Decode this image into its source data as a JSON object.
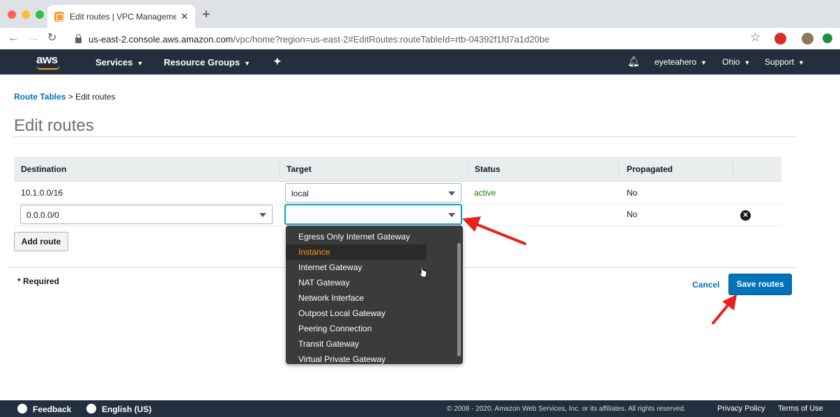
{
  "browser": {
    "tab_title": "Edit routes | VPC Management",
    "tab_close": "✕",
    "new_tab": "+",
    "url_host": "us-east-2.console.aws.amazon.com",
    "url_path": "/vpc/home?region=us-east-2#EditRoutes:routeTableId=rtb-04392f1fd7a1d20be",
    "traffic_colors": [
      "#fe5f57",
      "#febc2e",
      "#28c840"
    ]
  },
  "aws_header": {
    "logo": "aws",
    "services": "Services",
    "resource_groups": "Resource Groups",
    "user": "eyeteahero",
    "region": "Ohio",
    "support": "Support"
  },
  "breadcrumb": {
    "parent": "Route Tables",
    "separator": ">",
    "current": "Edit routes"
  },
  "page_title": "Edit routes",
  "table": {
    "headers": [
      "Destination",
      "Target",
      "Status",
      "Propagated"
    ],
    "rows": [
      {
        "destination": "10.1.0.0/16",
        "target": "local",
        "status": "active",
        "propagated": "No"
      },
      {
        "destination": "0.0.0.0/0",
        "target": "",
        "status": "",
        "propagated": "No"
      }
    ]
  },
  "buttons": {
    "add_route": "Add route",
    "required": "* Required",
    "cancel": "Cancel",
    "save": "Save routes"
  },
  "dropdown": {
    "items": [
      "Egress Only Internet Gateway",
      "Instance",
      "Internet Gateway",
      "NAT Gateway",
      "Network Interface",
      "Outpost Local Gateway",
      "Peering Connection",
      "Transit Gateway",
      "Virtual Private Gateway"
    ],
    "highlighted": "Instance"
  },
  "footer": {
    "feedback": "Feedback",
    "language": "English (US)",
    "copyright": "© 2008 - 2020, Amazon Web Services, Inc. or its affiliates. All rights reserved.",
    "privacy": "Privacy Policy",
    "terms": "Terms of Use"
  },
  "colors": {
    "aws_dark": "#232f3e",
    "aws_orange": "#ff9900",
    "link_blue": "#0073bb",
    "status_green": "#1d8102",
    "annotation_red": "#e8211c"
  }
}
